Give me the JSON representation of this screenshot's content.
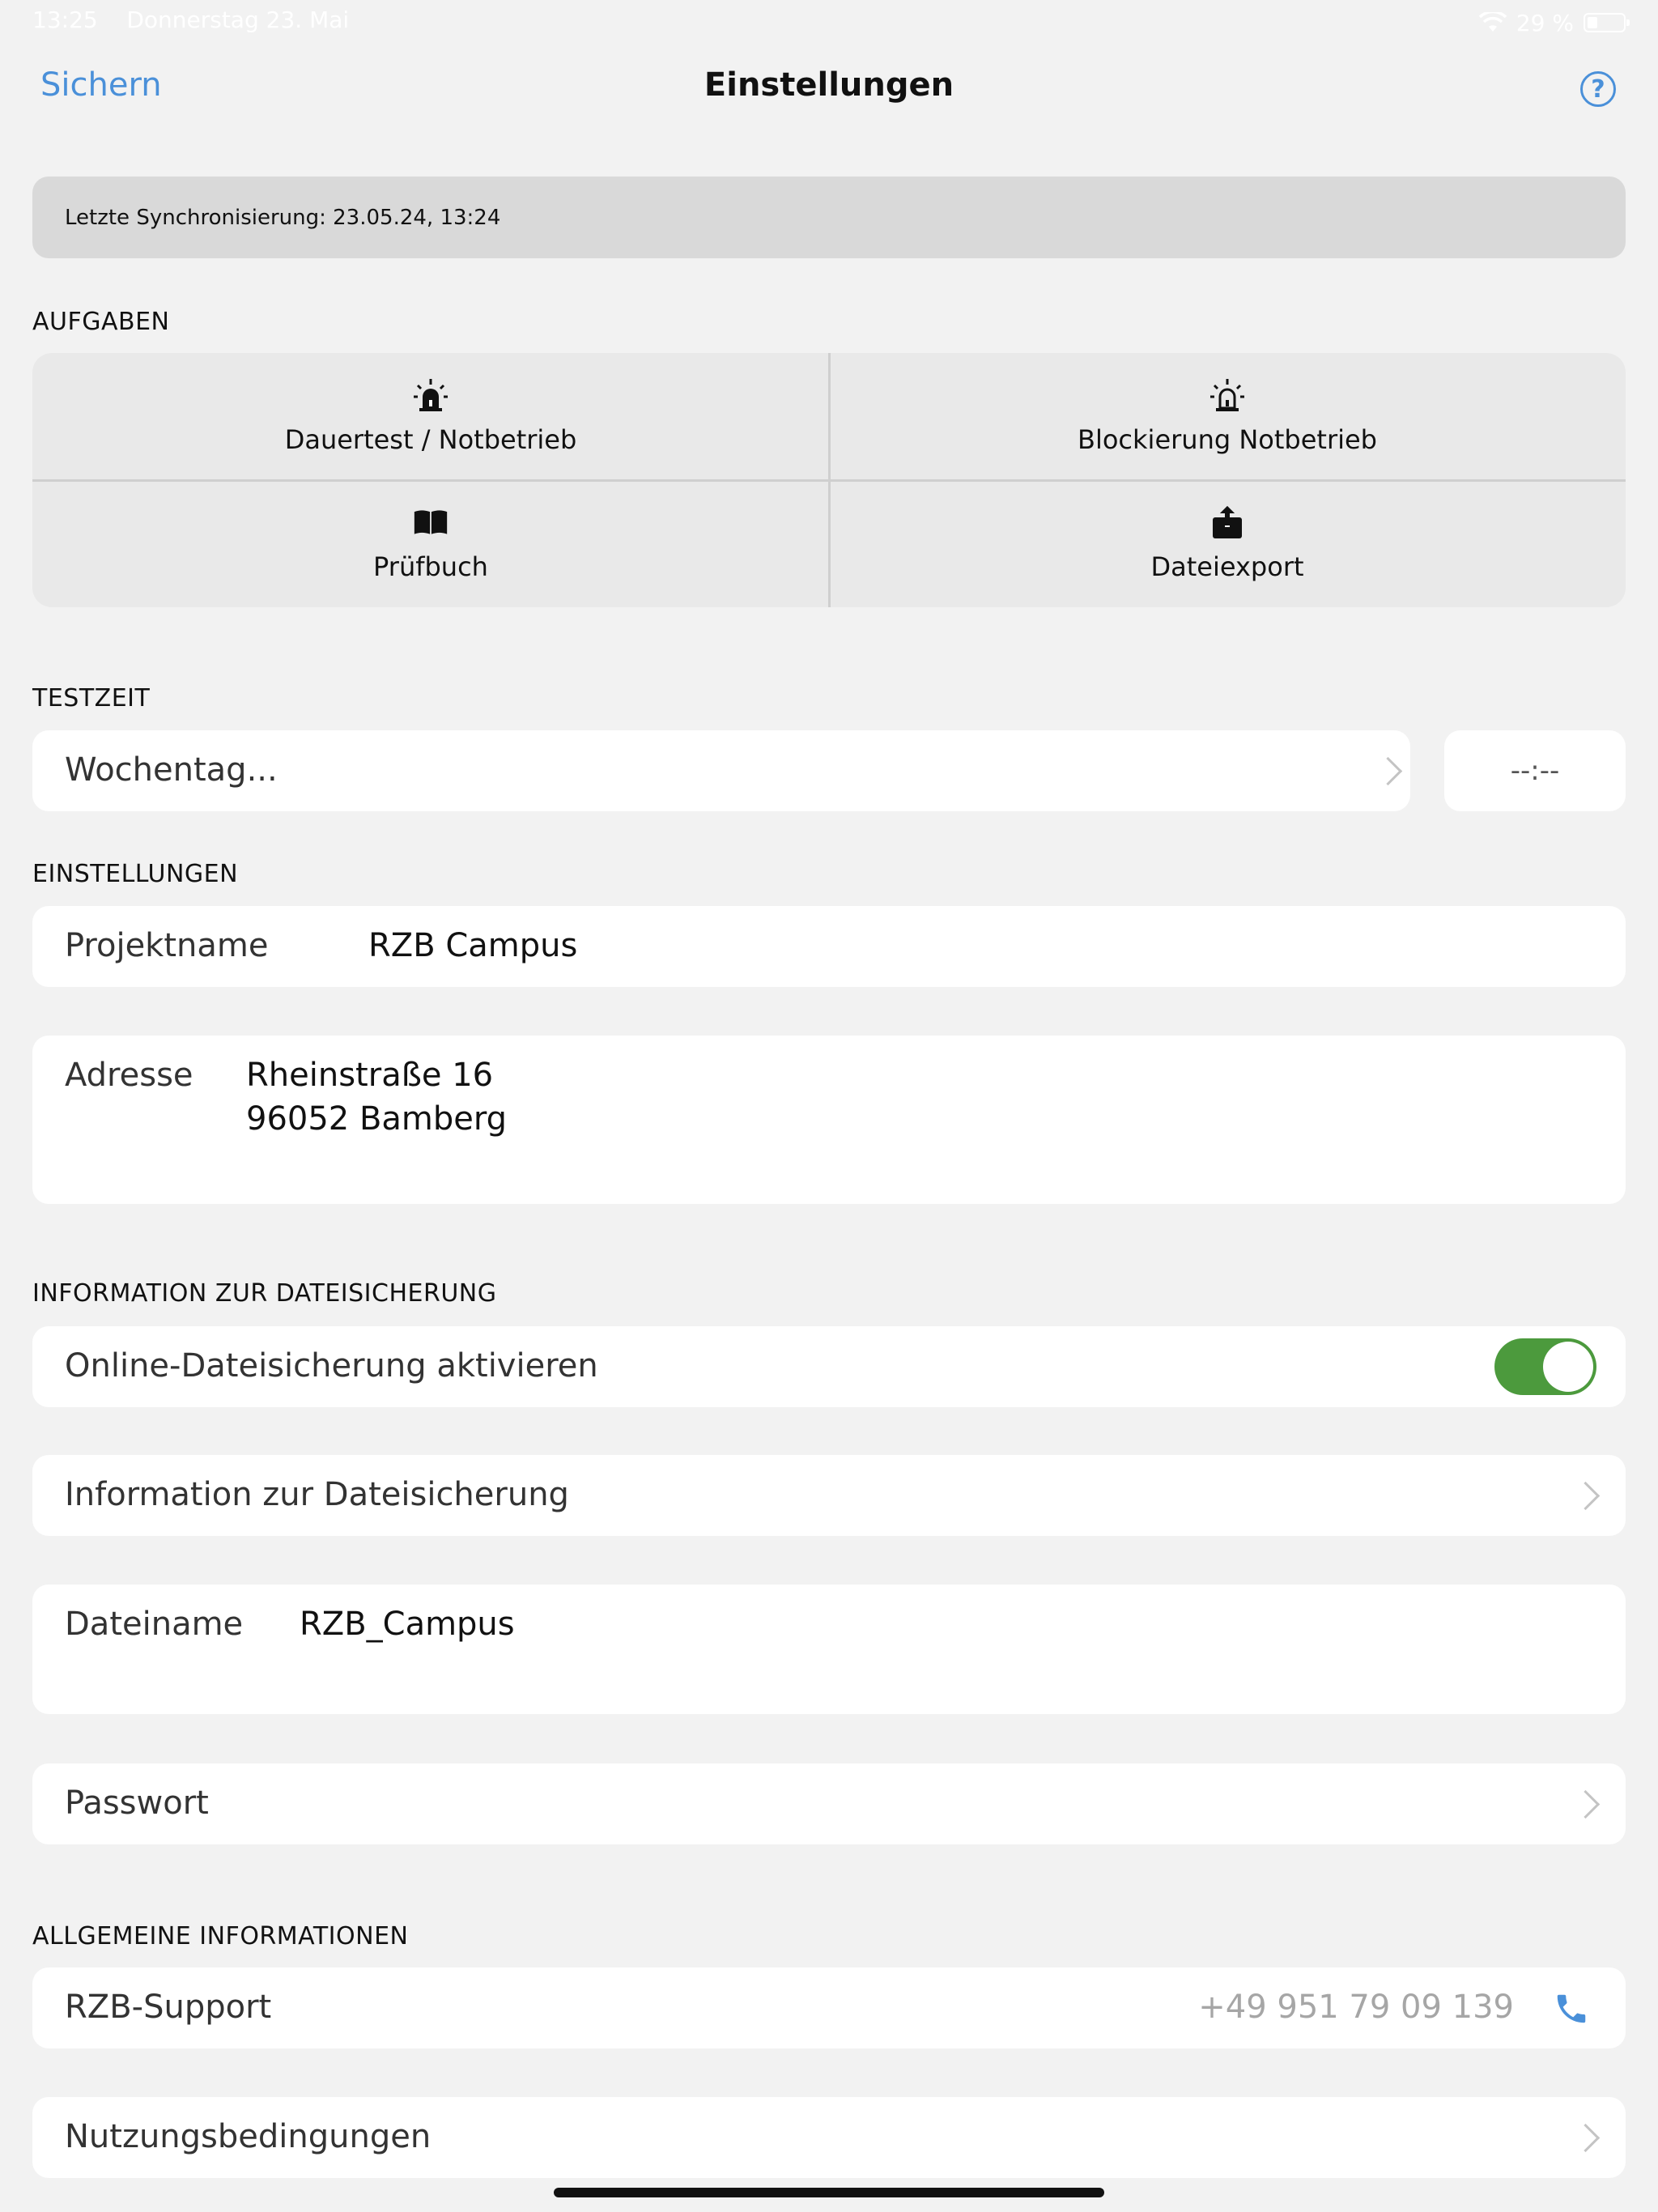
{
  "status_bar": {
    "time": "13:25",
    "date": "Donnerstag 23. Mai",
    "battery": "29 %"
  },
  "nav": {
    "save_label": "Sichern",
    "title": "Einstellungen",
    "help_label": "?"
  },
  "sync": {
    "text": "Letzte Synchronisierung: 23.05.24, 13:24"
  },
  "tasks": {
    "header": "AUFGABEN",
    "items": [
      {
        "label": "Dauertest / Notbetrieb",
        "icon": "alarm-light-icon"
      },
      {
        "label": "Blockierung Notbetrieb",
        "icon": "alarm-light-outline-icon"
      },
      {
        "label": "Prüfbuch",
        "icon": "book-icon"
      },
      {
        "label": "Dateiexport",
        "icon": "share-icon"
      }
    ]
  },
  "testzeit": {
    "header": "TESTZEIT",
    "weekday_placeholder": "Wochentag...",
    "time_placeholder": "--:--"
  },
  "settings": {
    "header": "EINSTELLUNGEN",
    "project_label": "Projektname",
    "project_value": "RZB Campus",
    "address_label": "Adresse",
    "address_line1": "Rheinstraße 16",
    "address_line2": "96052 Bamberg"
  },
  "backup": {
    "header": "INFORMATION ZUR DATEISICHERUNG",
    "online_label": "Online-Dateisicherung aktivieren",
    "online_enabled": true,
    "info_label": "Information zur Dateisicherung",
    "filename_label": "Dateiname",
    "filename_value": "RZB_Campus",
    "password_label": "Passwort"
  },
  "general": {
    "header": "ALLGEMEINE INFORMATIONEN",
    "support_label": "RZB-Support",
    "support_phone": "+49 951 79 09 139",
    "terms_label": "Nutzungsbedingungen"
  },
  "colors": {
    "accent": "#4a90d9",
    "toggle_on": "#4c9a3d",
    "background": "#f2f2f2"
  }
}
